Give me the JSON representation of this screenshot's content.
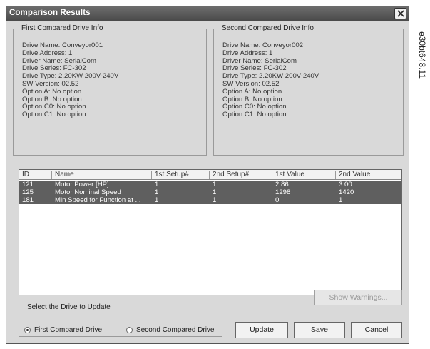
{
  "window": {
    "title": "Comparison Results"
  },
  "side_label": "e30bt648.11",
  "first_drive": {
    "title": "First Compared Drive Info",
    "lines": [
      "Drive Name: Conveyor001",
      "Drive Address: 1",
      "Driver Name: SerialCom",
      "Drive Series: FC-302",
      "Drive Type: 2.20KW 200V-240V",
      "SW Version: 02.52",
      "Option A: No option",
      "Option B: No option",
      "Option C0: No option",
      "Option C1: No option"
    ]
  },
  "second_drive": {
    "title": "Second Compared Drive Info",
    "lines": [
      "Drive Name: Conveyor002",
      "Drive Address: 1",
      "Driver Name: SerialCom",
      "Drive Series: FC-302",
      "Drive Type: 2.20KW 200V-240V",
      "SW Version: 02.52",
      "Option A: No option",
      "Option B: No option",
      "Option C0: No option",
      "Option C1: No option"
    ]
  },
  "table": {
    "columns": [
      "ID",
      "Name",
      "1st Setup#",
      "2nd Setup#",
      "1st Value",
      "2nd Value"
    ],
    "rows": [
      [
        "121",
        "Motor Power [HP]",
        "1",
        "1",
        "2.86",
        "3.00"
      ],
      [
        "125",
        "Motor Nominal Speed",
        "1",
        "1",
        "1298",
        "1420"
      ],
      [
        "181",
        "Min Speed for Function at ...",
        "1",
        "1",
        "0",
        "1"
      ]
    ]
  },
  "buttons": {
    "show_warnings": "Show Warnings...",
    "update": "Update",
    "save": "Save",
    "cancel": "Cancel"
  },
  "update_group": {
    "title": "Select the Drive to Update",
    "option_first": "First Compared Drive",
    "option_second": "Second Compared Drive",
    "selected": "first"
  }
}
